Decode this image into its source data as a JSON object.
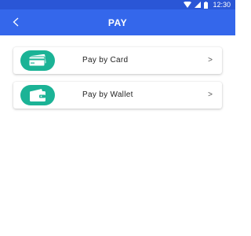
{
  "status_bar": {
    "time": "12:30",
    "icons": [
      "wifi-icon",
      "signal-icon",
      "battery-icon"
    ]
  },
  "app_bar": {
    "back_label": "<",
    "title": "PAY"
  },
  "payment_options": [
    {
      "label": "Pay by Card",
      "icon": "credit-card-icon",
      "chevron": ">"
    },
    {
      "label": "Pay by Wallet",
      "icon": "wallet-icon",
      "chevron": ">"
    }
  ],
  "colors": {
    "status_bar": "#2a56d6",
    "app_bar": "#3467eb",
    "icon_accent": "#1bb396"
  }
}
